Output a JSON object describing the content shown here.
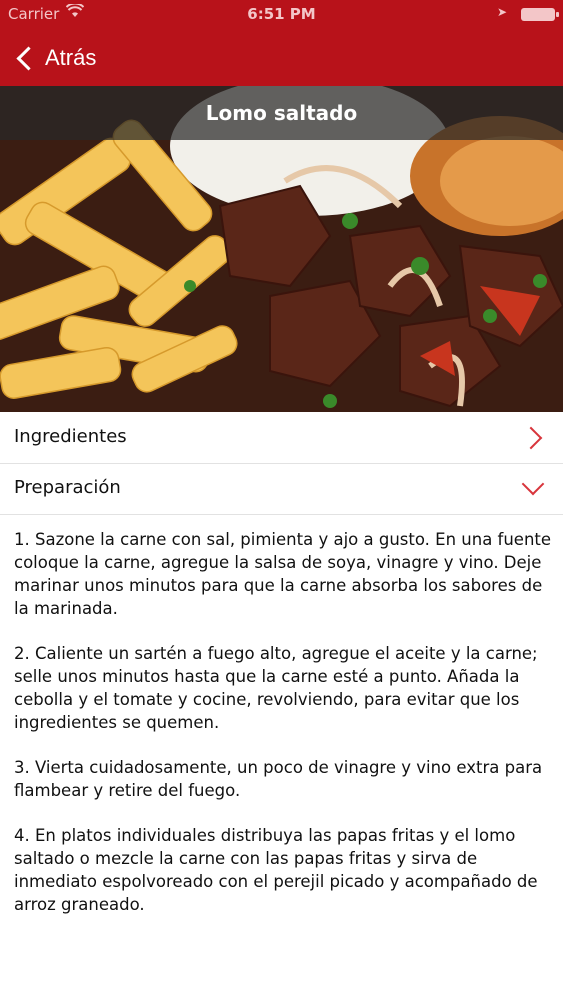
{
  "status_bar": {
    "carrier": "Carrier",
    "time": "6:51 PM",
    "wifi_icon": "wifi-icon",
    "location_icon": "location-arrow-icon",
    "battery_icon": "battery-icon"
  },
  "nav": {
    "back_label": "Atrás",
    "back_icon": "chevron-left-icon",
    "background": "#b8121a"
  },
  "recipe": {
    "title": "Lomo saltado",
    "image": "lomo-saltado-photo"
  },
  "sections": [
    {
      "label": "Ingredientes",
      "state": "collapsed",
      "icon": "chevron-right-icon"
    },
    {
      "label": "Preparación",
      "state": "expanded",
      "icon": "chevron-down-icon"
    }
  ],
  "preparation_steps": [
    "1. Sazone la carne con sal, pimienta y ajo a gusto. En una fuente coloque la carne, agregue la salsa de soya, vinagre y vino. Deje marinar unos minutos para que la carne absorba los sabores de la marinada.",
    "2. Caliente un sartén a fuego alto, agregue el aceite y la carne; selle unos minutos hasta que la carne esté a punto. Añada la cebolla y el tomate y cocine, revolviendo, para evitar que los ingredientes se quemen.",
    "3. Vierta cuidadosamente, un poco de vinagre y vino extra para flambear y retire del fuego.",
    "4. En platos individuales distribuya las papas fritas y el lomo saltado o mezcle la carne con las papas fritas y sirva de inmediato espolvoreado con el perejil picado y acompañado de arroz graneado."
  ],
  "accent_color": "#d8353c"
}
